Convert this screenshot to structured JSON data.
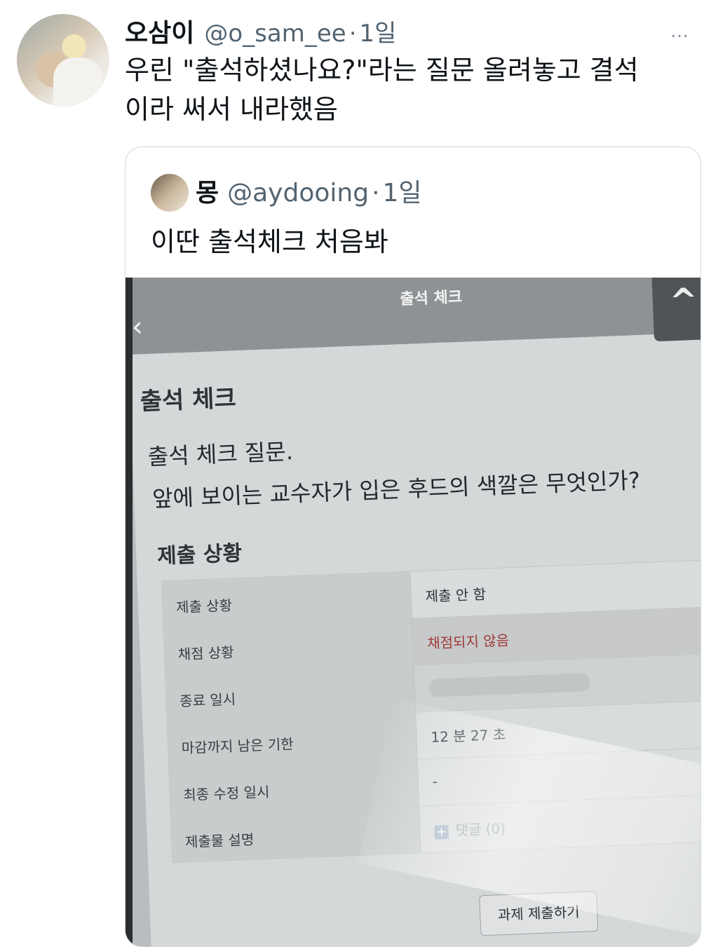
{
  "tweet": {
    "display_name": "오삼이",
    "handle": "@o_sam_ee",
    "separator": "·",
    "time": "1일",
    "more_icon": "…",
    "text": "우린 \"출석하셨나요?\"라는 질문 올려놓고 결석\n이라 써서 내라했음"
  },
  "quoted_tweet": {
    "display_name": "몽",
    "handle": "@aydooing",
    "separator": "·",
    "time": "1일",
    "text": "이딴 출석체크 처음봐"
  },
  "photo": {
    "topbar_title": "출석 체크",
    "back_icon": "‹",
    "collapse_icon": "^",
    "page_heading": "출석 체크",
    "question_line1": "출석 체크 질문.",
    "question_line2": "앞에 보이는 교수자가 입은 후드의 색깔은 무엇인가?",
    "status_heading": "제출 상황",
    "rows": [
      {
        "label": "제출 상황",
        "value": "제출 안 함"
      },
      {
        "label": "채점 상황",
        "value": "채점되지 않음"
      },
      {
        "label": "종료 일시",
        "value": ""
      },
      {
        "label": "마감까지 남은 기한",
        "value": "12 분 27 초"
      },
      {
        "label": "최종 수정 일시",
        "value": "-"
      },
      {
        "label": "제출물 설명",
        "value": "댓글 (0)"
      }
    ],
    "submit_button": "과제 제출하기"
  }
}
